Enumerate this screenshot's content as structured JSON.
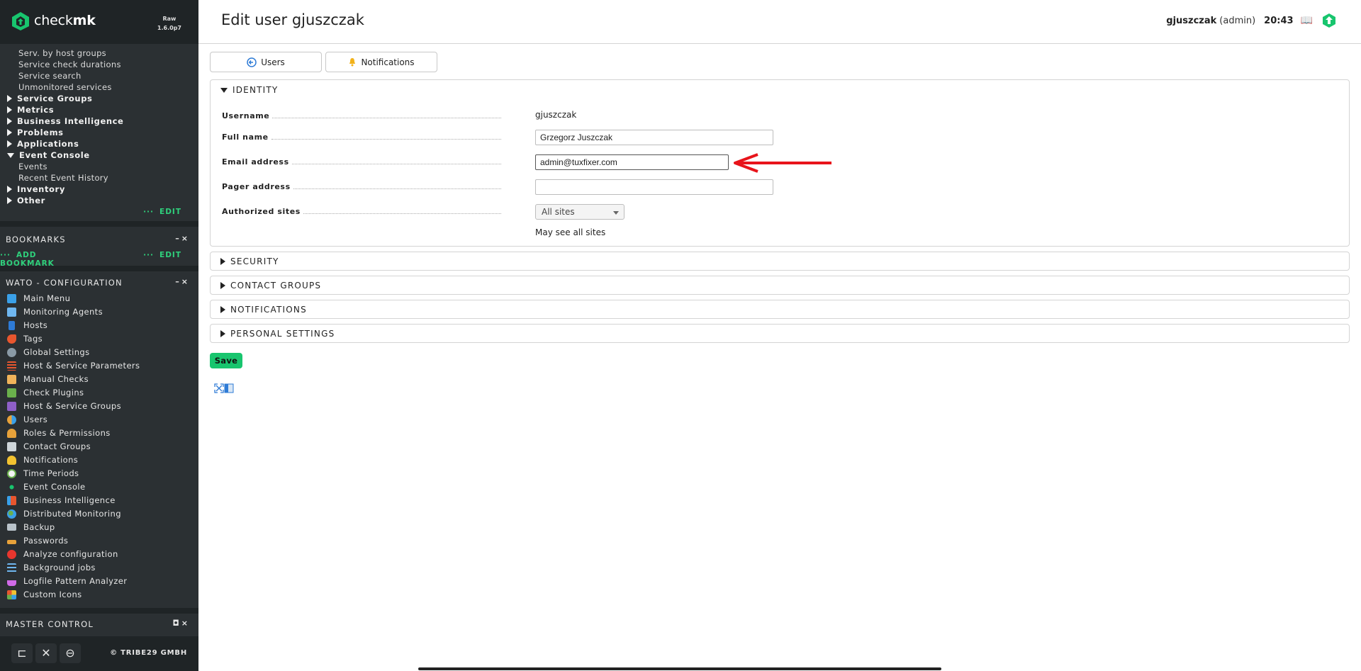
{
  "brand": {
    "name_prefix": "check",
    "name_suffix": "mk",
    "edition_line1": "Raw",
    "edition_line2": "1.6.0p7",
    "accent_color": "#18c56e"
  },
  "views": {
    "partial_top": "Serv. by host groups",
    "links_top": [
      "Service check durations",
      "Service search",
      "Unmonitored services"
    ],
    "groups": [
      {
        "label": "Service Groups",
        "expanded": false
      },
      {
        "label": "Metrics",
        "expanded": false
      },
      {
        "label": "Business Intelligence",
        "expanded": false
      },
      {
        "label": "Problems",
        "expanded": false
      },
      {
        "label": "Applications",
        "expanded": false
      },
      {
        "label": "Event Console",
        "expanded": true
      }
    ],
    "event_console_links": [
      "Events",
      "Recent Event History"
    ],
    "groups_after": [
      {
        "label": "Inventory",
        "expanded": false
      },
      {
        "label": "Other",
        "expanded": false
      }
    ],
    "edit_label": "EDIT"
  },
  "bookmarks": {
    "title": "BOOKMARKS",
    "add_label": "ADD BOOKMARK",
    "edit_label": "EDIT"
  },
  "wato": {
    "title": "WATO - CONFIGURATION",
    "items": [
      {
        "label": "Main Menu",
        "icon": "main-menu-icon"
      },
      {
        "label": "Monitoring Agents",
        "icon": "agents-icon"
      },
      {
        "label": "Hosts",
        "icon": "hosts-icon"
      },
      {
        "label": "Tags",
        "icon": "tags-icon"
      },
      {
        "label": "Global Settings",
        "icon": "gear-icon"
      },
      {
        "label": "Host & Service Parameters",
        "icon": "parameters-icon"
      },
      {
        "label": "Manual Checks",
        "icon": "hand-icon"
      },
      {
        "label": "Check Plugins",
        "icon": "puzzle-icon"
      },
      {
        "label": "Host & Service Groups",
        "icon": "groups-icon"
      },
      {
        "label": "Users",
        "icon": "users-icon"
      },
      {
        "label": "Roles & Permissions",
        "icon": "roles-icon"
      },
      {
        "label": "Contact Groups",
        "icon": "contact-groups-icon"
      },
      {
        "label": "Notifications",
        "icon": "bell-icon"
      },
      {
        "label": "Time Periods",
        "icon": "clock-icon"
      },
      {
        "label": "Event Console",
        "icon": "event-console-icon"
      },
      {
        "label": "Business Intelligence",
        "icon": "bi-icon"
      },
      {
        "label": "Distributed Monitoring",
        "icon": "globe-icon"
      },
      {
        "label": "Backup",
        "icon": "backup-icon"
      },
      {
        "label": "Passwords",
        "icon": "key-icon"
      },
      {
        "label": "Analyze configuration",
        "icon": "analyze-icon"
      },
      {
        "label": "Background jobs",
        "icon": "list-icon"
      },
      {
        "label": "Logfile Pattern Analyzer",
        "icon": "flask-icon"
      },
      {
        "label": "Custom Icons",
        "icon": "custom-icons-icon"
      }
    ]
  },
  "master_control": {
    "title": "MASTER CONTROL"
  },
  "sidebar_footer": {
    "copyright": "© TRIBE29 GMBH"
  },
  "header": {
    "title": "Edit user gjuszczak",
    "username": "gjuszczak",
    "role": "(admin)",
    "time": "20:43"
  },
  "tabs": {
    "users_label": "Users",
    "notifications_label": "Notifications"
  },
  "identity": {
    "title": "IDENTITY",
    "username_label": "Username",
    "username_value": "gjuszczak",
    "fullname_label": "Full name",
    "fullname_value": "Grzegorz Juszczak",
    "email_label": "Email address",
    "email_value": "admin@tuxfixer.com",
    "pager_label": "Pager address",
    "pager_value": "",
    "sites_label": "Authorized sites",
    "sites_value": "All sites",
    "sites_note": "May see all sites"
  },
  "sections": {
    "security": "SECURITY",
    "contact_groups": "CONTACT GROUPS",
    "notifications": "NOTIFICATIONS",
    "personal_settings": "PERSONAL SETTINGS"
  },
  "save_label": "Save",
  "annotation": {
    "arrow_color": "#e8141b"
  }
}
